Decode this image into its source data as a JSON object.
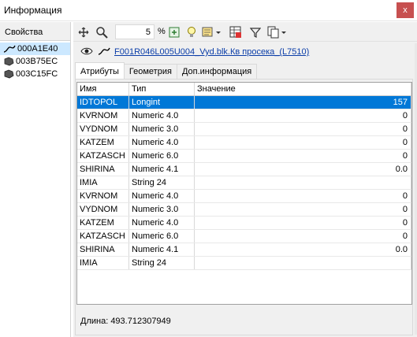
{
  "window": {
    "title": "Информация",
    "close_label": "x"
  },
  "left_panel": {
    "header": "Свойства",
    "items": [
      {
        "label": "000A1E40",
        "icon": "line-icon",
        "selected": true
      },
      {
        "label": "003B75EC",
        "icon": "polygon-icon",
        "selected": false
      },
      {
        "label": "003C15FC",
        "icon": "polygon-icon",
        "selected": false
      }
    ]
  },
  "toolbar": {
    "zoom_value": "5",
    "percent_label": "%",
    "icons": [
      "move-icon",
      "zoom-icon",
      "zoom-box",
      "fit-icon",
      "lightbulb-icon",
      "layer-icon",
      "filter-icon",
      "copy-icon"
    ]
  },
  "object": {
    "link": "F001R046L005U004_Vyd.blk.Кв просека_(L7510)"
  },
  "tabs": [
    {
      "label": "Атрибуты",
      "active": true
    },
    {
      "label": "Геометрия",
      "active": false
    },
    {
      "label": "Доп.информация",
      "active": false
    }
  ],
  "table": {
    "columns": [
      "Имя",
      "Тип",
      "Значение"
    ],
    "rows": [
      {
        "name": "IDTOPOL",
        "type": "Longint",
        "value": "157",
        "selected": true
      },
      {
        "name": "KVRNOM",
        "type": "Numeric 4.0",
        "value": "0"
      },
      {
        "name": "VYDNOM",
        "type": "Numeric 3.0",
        "value": "0"
      },
      {
        "name": "KATZEM",
        "type": "Numeric 4.0",
        "value": "0"
      },
      {
        "name": "KATZASCH",
        "type": "Numeric 6.0",
        "value": "0"
      },
      {
        "name": "SHIRINA",
        "type": "Numeric 4.1",
        "value": "0.0"
      },
      {
        "name": "IMIA",
        "type": "String 24",
        "value": ""
      },
      {
        "name": "KVRNOM",
        "type": "Numeric 4.0",
        "value": "0"
      },
      {
        "name": "VYDNOM",
        "type": "Numeric 3.0",
        "value": "0"
      },
      {
        "name": "KATZEM",
        "type": "Numeric 4.0",
        "value": "0"
      },
      {
        "name": "KATZASCH",
        "type": "Numeric 6.0",
        "value": "0"
      },
      {
        "name": "SHIRINA",
        "type": "Numeric 4.1",
        "value": "0.0"
      },
      {
        "name": "IMIA",
        "type": "String 24",
        "value": ""
      }
    ]
  },
  "status": {
    "length_text": "Длина: 493.712307949"
  },
  "colors": {
    "selection": "#0078d7",
    "tree_selection": "#cce8ff",
    "link": "#0a3da8"
  }
}
